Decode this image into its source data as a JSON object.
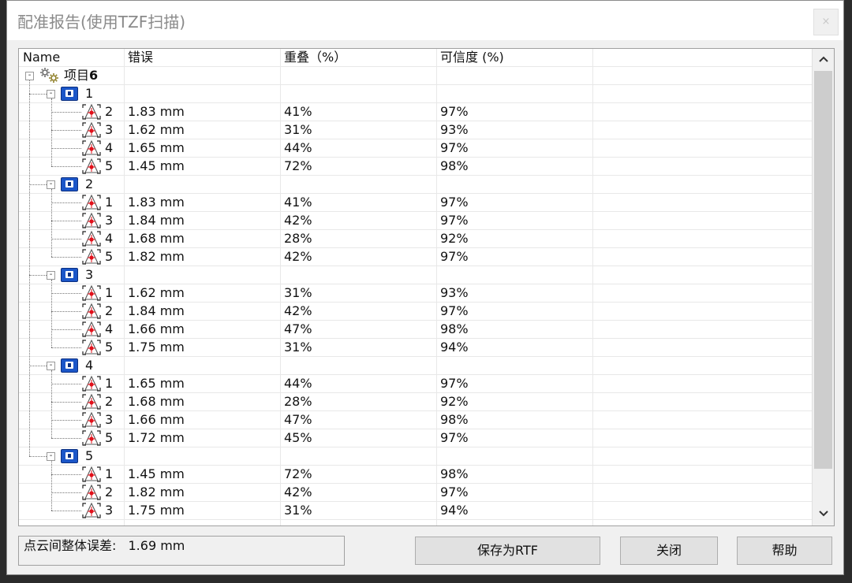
{
  "window": {
    "title": "配准报告(使用TZF扫描)",
    "close_glyph": "×"
  },
  "table": {
    "headers": [
      "Name",
      "错误",
      "重叠（%）",
      "可信度 (%)"
    ],
    "project_label_prefix": "项目",
    "project_label_num": "6",
    "groups": [
      {
        "label": "1",
        "rows": [
          {
            "name": "2",
            "error": "1.83 mm",
            "overlap": "41%",
            "confidence": "97%"
          },
          {
            "name": "3",
            "error": "1.62 mm",
            "overlap": "31%",
            "confidence": "93%"
          },
          {
            "name": "4",
            "error": "1.65 mm",
            "overlap": "44%",
            "confidence": "97%"
          },
          {
            "name": "5",
            "error": "1.45 mm",
            "overlap": "72%",
            "confidence": "98%"
          }
        ]
      },
      {
        "label": "2",
        "rows": [
          {
            "name": "1",
            "error": "1.83 mm",
            "overlap": "41%",
            "confidence": "97%"
          },
          {
            "name": "3",
            "error": "1.84 mm",
            "overlap": "42%",
            "confidence": "97%"
          },
          {
            "name": "4",
            "error": "1.68 mm",
            "overlap": "28%",
            "confidence": "92%"
          },
          {
            "name": "5",
            "error": "1.82 mm",
            "overlap": "42%",
            "confidence": "97%"
          }
        ]
      },
      {
        "label": "3",
        "rows": [
          {
            "name": "1",
            "error": "1.62 mm",
            "overlap": "31%",
            "confidence": "93%"
          },
          {
            "name": "2",
            "error": "1.84 mm",
            "overlap": "42%",
            "confidence": "97%"
          },
          {
            "name": "4",
            "error": "1.66 mm",
            "overlap": "47%",
            "confidence": "98%"
          },
          {
            "name": "5",
            "error": "1.75 mm",
            "overlap": "31%",
            "confidence": "94%"
          }
        ]
      },
      {
        "label": "4",
        "rows": [
          {
            "name": "1",
            "error": "1.65 mm",
            "overlap": "44%",
            "confidence": "97%"
          },
          {
            "name": "2",
            "error": "1.68 mm",
            "overlap": "28%",
            "confidence": "92%"
          },
          {
            "name": "3",
            "error": "1.66 mm",
            "overlap": "47%",
            "confidence": "98%"
          },
          {
            "name": "5",
            "error": "1.72 mm",
            "overlap": "45%",
            "confidence": "97%"
          }
        ]
      },
      {
        "label": "5",
        "rows": [
          {
            "name": "1",
            "error": "1.45 mm",
            "overlap": "72%",
            "confidence": "98%"
          },
          {
            "name": "2",
            "error": "1.82 mm",
            "overlap": "42%",
            "confidence": "97%"
          },
          {
            "name": "3",
            "error": "1.75 mm",
            "overlap": "31%",
            "confidence": "94%"
          }
        ]
      }
    ]
  },
  "status": {
    "label": "点云间整体误差:",
    "value": "1.69 mm"
  },
  "buttons": {
    "save": "保存为RTF",
    "close": "关闭",
    "help": "帮助"
  },
  "icons": {
    "expander": "-",
    "scroll_up": "^",
    "scroll_down": "v",
    "project": "gears-icon",
    "scan": "scanner-icon",
    "registration": "registration-target-icon"
  },
  "colors": {
    "scan_icon": "#1b56c8",
    "target_red": "#e0101a"
  }
}
